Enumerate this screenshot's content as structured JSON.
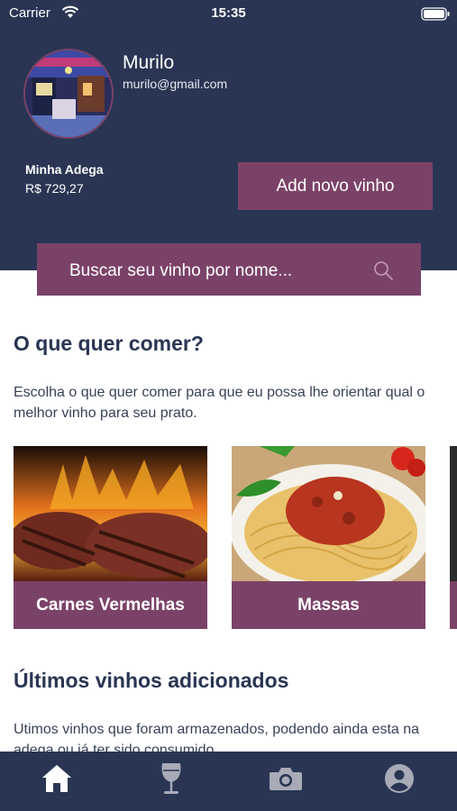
{
  "status_bar": {
    "carrier": "Carrier",
    "time": "15:35"
  },
  "profile": {
    "name": "Murilo",
    "email": "murilo@gmail.com"
  },
  "cellar": {
    "title": "Minha Adega",
    "value": "R$ 729,27"
  },
  "actions": {
    "add_wine_label": "Add novo vinho"
  },
  "search": {
    "placeholder": "Buscar seu vinho por nome..."
  },
  "food_section": {
    "title": "O que quer comer?",
    "description": "Escolha o que quer comer para que eu possa lhe orientar qual o melhor vinho para seu prato.",
    "cards": [
      {
        "label": "Carnes Vermelhas"
      },
      {
        "label": "Massas"
      }
    ]
  },
  "recent_section": {
    "title": "Últimos vinhos adicionados",
    "description": "Utimos vinhos que foram armazenados, podendo ainda esta na adega ou já ter sido consumido."
  },
  "tabs": [
    {
      "icon": "home-icon",
      "active": true
    },
    {
      "icon": "wine-glass-icon",
      "active": false
    },
    {
      "icon": "camera-icon",
      "active": false
    },
    {
      "icon": "account-icon",
      "active": false
    }
  ],
  "colors": {
    "header_bg": "#293553",
    "accent": "#7b4268",
    "text_dark": "#293553"
  }
}
